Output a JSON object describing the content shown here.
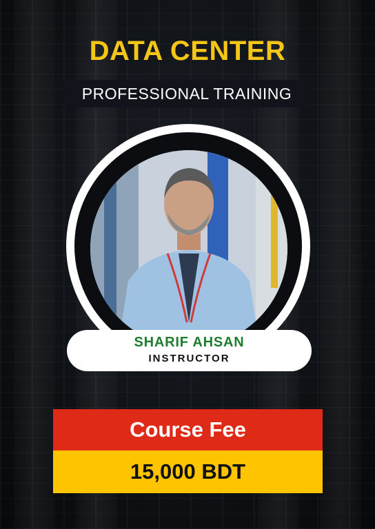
{
  "header": {
    "title": "DATA CENTER",
    "subtitle": "PROFESSIONAL TRAINING"
  },
  "instructor": {
    "name": "SHARIF AHSAN",
    "role": "INSTRUCTOR"
  },
  "fee": {
    "label": "Course Fee",
    "amount": "15,000 BDT"
  },
  "colors": {
    "title": "#f5c518",
    "name": "#1e7d2e",
    "fee_header": "#e02a18",
    "fee_body": "#ffc400"
  }
}
